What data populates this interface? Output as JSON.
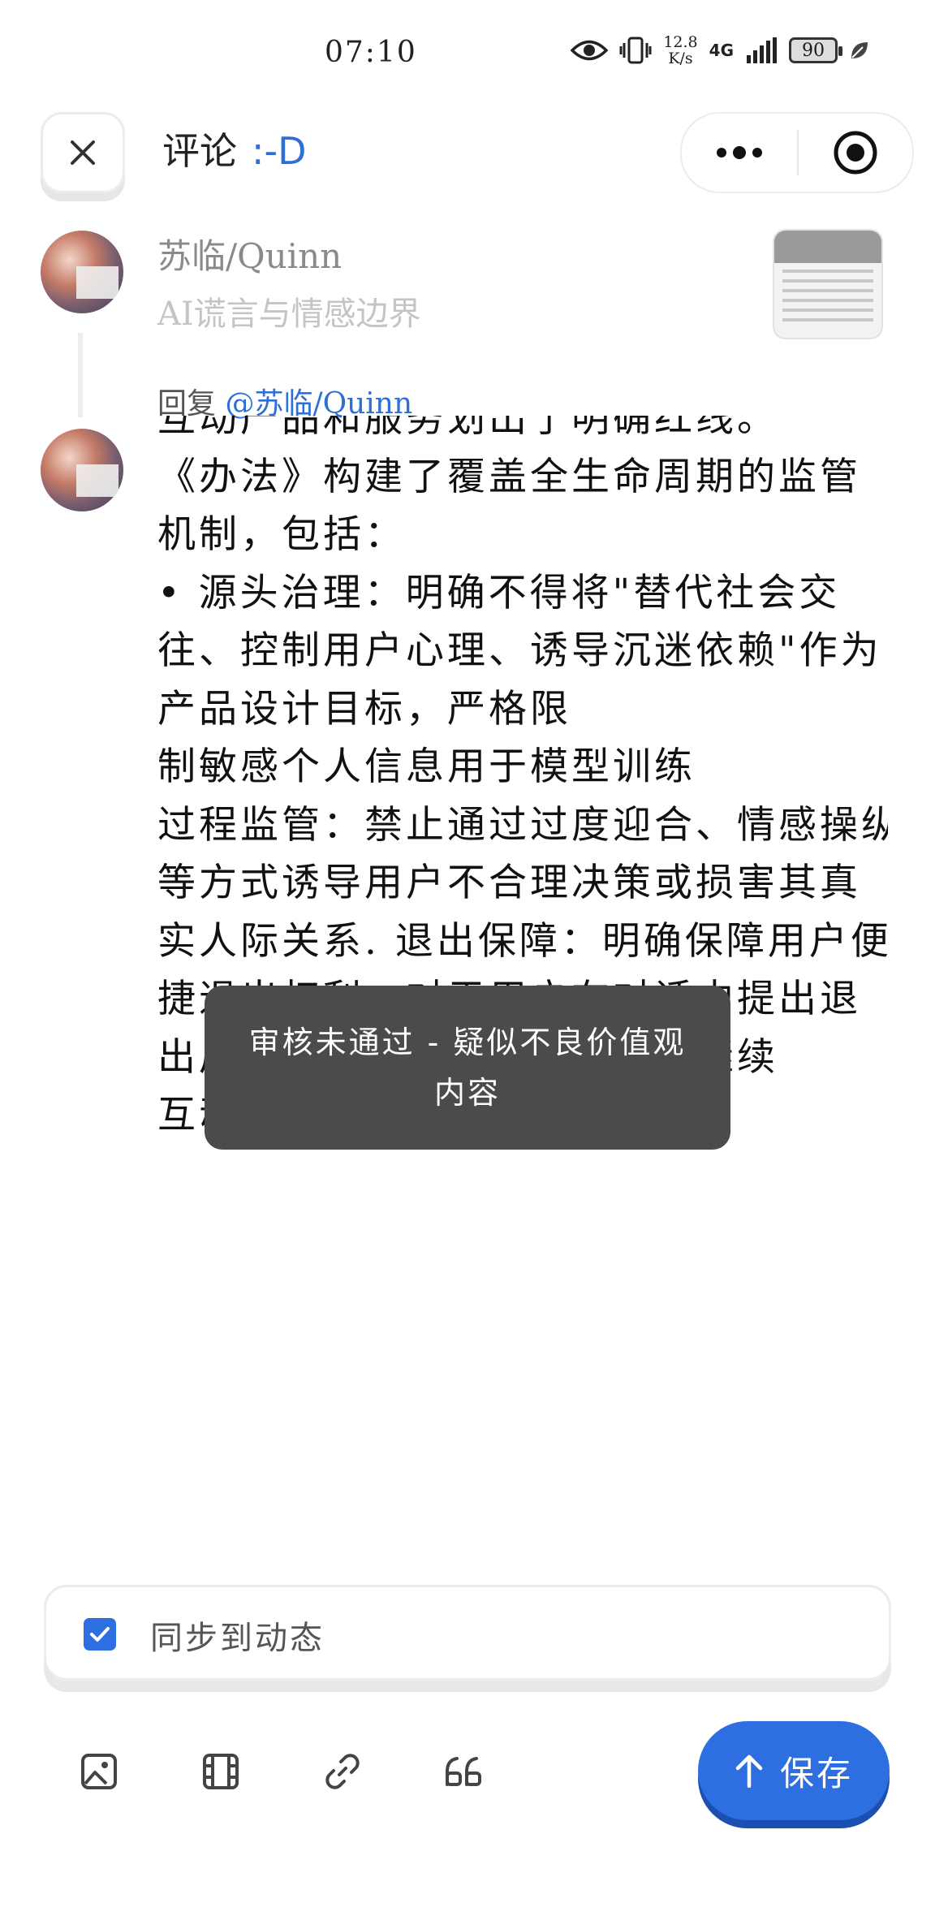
{
  "status_bar": {
    "time": "07:10",
    "speed_value": "12.8",
    "speed_unit": "K/s",
    "network": "4G",
    "battery": "90",
    "icons": [
      "eye-icon",
      "vibrate-icon",
      "signal-icon",
      "leaf-icon"
    ]
  },
  "header": {
    "title": "评论",
    "emoticon": ":-D",
    "menu_icon": "more-dots-icon",
    "target_icon": "target-icon"
  },
  "parent_comment": {
    "author": "苏临/Quinn",
    "post_title": "AI谎言与情感边界"
  },
  "reply": {
    "prefix": "回复",
    "mention": "@苏临/Quinn"
  },
  "editor": {
    "lines": [
      "互动产品和服务划出了明确红线。",
      "《办法》构建了覆盖全生命周期的监管",
      "机制，包括：",
      "•  源头治理：明确不得将\"替代社会交",
      "往、控制用户心理、诱导沉迷依赖\"作为",
      "产品设计目标，严格限",
      "制敏感个人信息用于模型训练",
      "过程监管：禁止通过过度迎合、情感操纵",
      "等方式诱导用户不合理决策或损害其真",
      "实人际关系. 退出保障：明确保障用户便",
      "捷退出权利，对于用户在对话中提出退",
      "出后不得以纠缠、挽留等方式继续",
      "互动等方式纠问"
    ]
  },
  "toast": {
    "message": "审核未通过 - 疑似不良价值观内容"
  },
  "sync": {
    "label": "同步到动态",
    "checked": true
  },
  "toolbar": {
    "tools": [
      "image-icon",
      "video-icon",
      "link-icon",
      "quote-icon"
    ],
    "save_label": "保存",
    "accent": "#2d6fe0"
  }
}
